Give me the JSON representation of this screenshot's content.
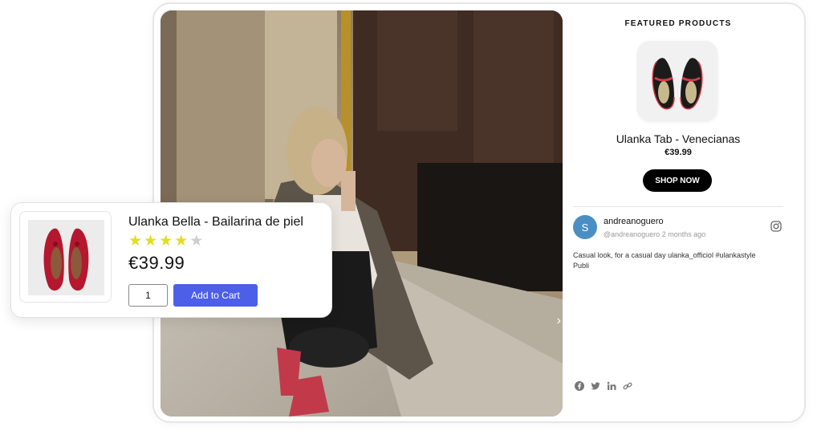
{
  "featured": {
    "title": "FEATURED PRODUCTS",
    "product_name": "Ulanka Tab - Venecianas",
    "price": "€39.99",
    "shop_now_label": "SHOP NOW"
  },
  "post": {
    "avatar_initial": "S",
    "author": "andreanoguero",
    "handle_time": "@andreanoguero 2 months ago",
    "caption_line1": "Casual look, for a casual day  ulanka_officiol #ulankastyle",
    "caption_line2": "Publi",
    "source_icon": "instagram-icon"
  },
  "share_icons": [
    "facebook-icon",
    "twitter-icon",
    "linkedin-icon",
    "link-icon"
  ],
  "photo_nav": "›",
  "popup": {
    "title": "Ulanka Bella - Bailarina de piel",
    "rating": 4,
    "rating_max": 5,
    "star_glyph": "★",
    "price": "€39.99",
    "quantity": "1",
    "add_to_cart_label": "Add to Cart"
  },
  "colors": {
    "add_to_cart": "#4d5fe8",
    "shop_now": "#000000",
    "star_filled": "#e3dd1d",
    "star_empty": "#cdcdcd",
    "avatar": "#4a8fc4"
  }
}
